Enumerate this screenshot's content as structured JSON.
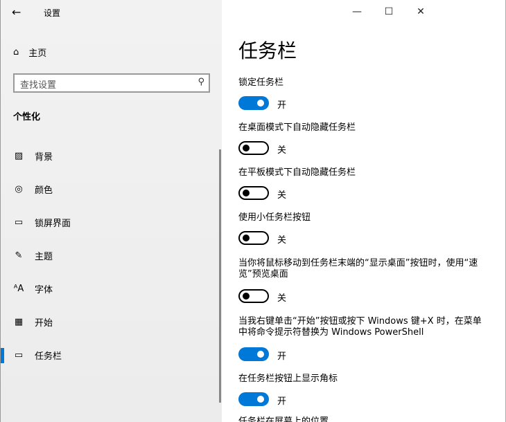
{
  "window": {
    "title": "设置",
    "minimize": "—",
    "maximize": "☐",
    "close": "✕",
    "back": "←"
  },
  "sidebar": {
    "home": "主页",
    "search_placeholder": "查找设置",
    "section": "个性化",
    "items": [
      {
        "icon": "image-icon",
        "glyph": "▨",
        "label": "背景"
      },
      {
        "icon": "palette-icon",
        "glyph": "◎",
        "label": "颜色"
      },
      {
        "icon": "lock-screen-icon",
        "glyph": "▭",
        "label": "锁屏界面"
      },
      {
        "icon": "theme-icon",
        "glyph": "✎",
        "label": "主题"
      },
      {
        "icon": "font-icon",
        "glyph": "ᴬA",
        "label": "字体"
      },
      {
        "icon": "start-icon",
        "glyph": "▦",
        "label": "开始"
      },
      {
        "icon": "taskbar-icon",
        "glyph": "▭",
        "label": "任务栏",
        "selected": true
      }
    ]
  },
  "main": {
    "title": "任务栏",
    "settings": [
      {
        "label": "锁定任务栏",
        "on": true,
        "state": "开"
      },
      {
        "label": "在桌面模式下自动隐藏任务栏",
        "on": false,
        "state": "关"
      },
      {
        "label": "在平板模式下自动隐藏任务栏",
        "on": false,
        "state": "关"
      },
      {
        "label": "使用小任务栏按钮",
        "on": false,
        "state": "关"
      },
      {
        "label": "当你将鼠标移动到任务栏末端的“显示桌面”按钮时，使用“速览”预览桌面",
        "on": false,
        "state": "关"
      },
      {
        "label": "当我右键单击“开始”按钮或按下 Windows 键+X 时，在菜单中将命令提示符替换为 Windows PowerShell",
        "on": true,
        "state": "开"
      },
      {
        "label": "在任务栏按钮上显示角标",
        "on": true,
        "state": "开"
      }
    ],
    "next_label": "任务栏在屏幕上的位置"
  },
  "colors": {
    "accent": "#0078d7"
  }
}
